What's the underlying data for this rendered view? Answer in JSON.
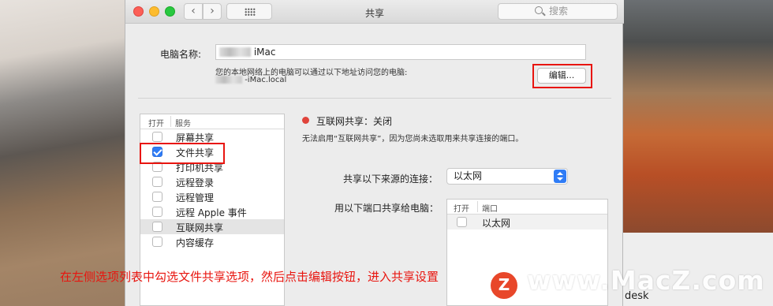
{
  "window": {
    "title": "共享",
    "back_glyph": "‹",
    "forward_glyph": "›",
    "search_placeholder": "搜索"
  },
  "computer_name": {
    "label": "电脑名称:",
    "value": "iMac",
    "description": "您的本地网络上的电脑可以通过以下地址访问您的电脑:",
    "address": "-iMac.local",
    "edit_button": "编辑..."
  },
  "services": {
    "header_on": "打开",
    "header_service": "服务",
    "items": [
      {
        "label": "屏幕共享",
        "checked": false,
        "selected": false
      },
      {
        "label": "文件共享",
        "checked": true,
        "selected": false
      },
      {
        "label": "打印机共享",
        "checked": false,
        "selected": false
      },
      {
        "label": "远程登录",
        "checked": false,
        "selected": false
      },
      {
        "label": "远程管理",
        "checked": false,
        "selected": false
      },
      {
        "label": "远程 Apple 事件",
        "checked": false,
        "selected": false
      },
      {
        "label": "互联网共享",
        "checked": false,
        "selected": true
      },
      {
        "label": "内容缓存",
        "checked": false,
        "selected": false
      }
    ]
  },
  "detail": {
    "status": "互联网共享：关闭",
    "status_color": "#e0443b",
    "note": "无法启用“互联网共享”，因为您尚未选取用来共享连接的端口。",
    "share_from_label": "共享以下来源的连接：",
    "share_from_value": "以太网",
    "ports_label": "用以下端口共享给电脑：",
    "ports_header_on": "打开",
    "ports_header_port": "端口",
    "ports": [
      {
        "label": "以太网",
        "checked": false
      }
    ]
  },
  "annotation": {
    "instruction": "在左侧选项列表中勾选文件共享选项，然后点击编辑按钮，进入共享设置",
    "highlight_color": "#e8150f"
  },
  "watermark": {
    "logo_letter": "Z",
    "text": "www.MacZ.com"
  },
  "desktop": {
    "partial_text": "desk"
  }
}
